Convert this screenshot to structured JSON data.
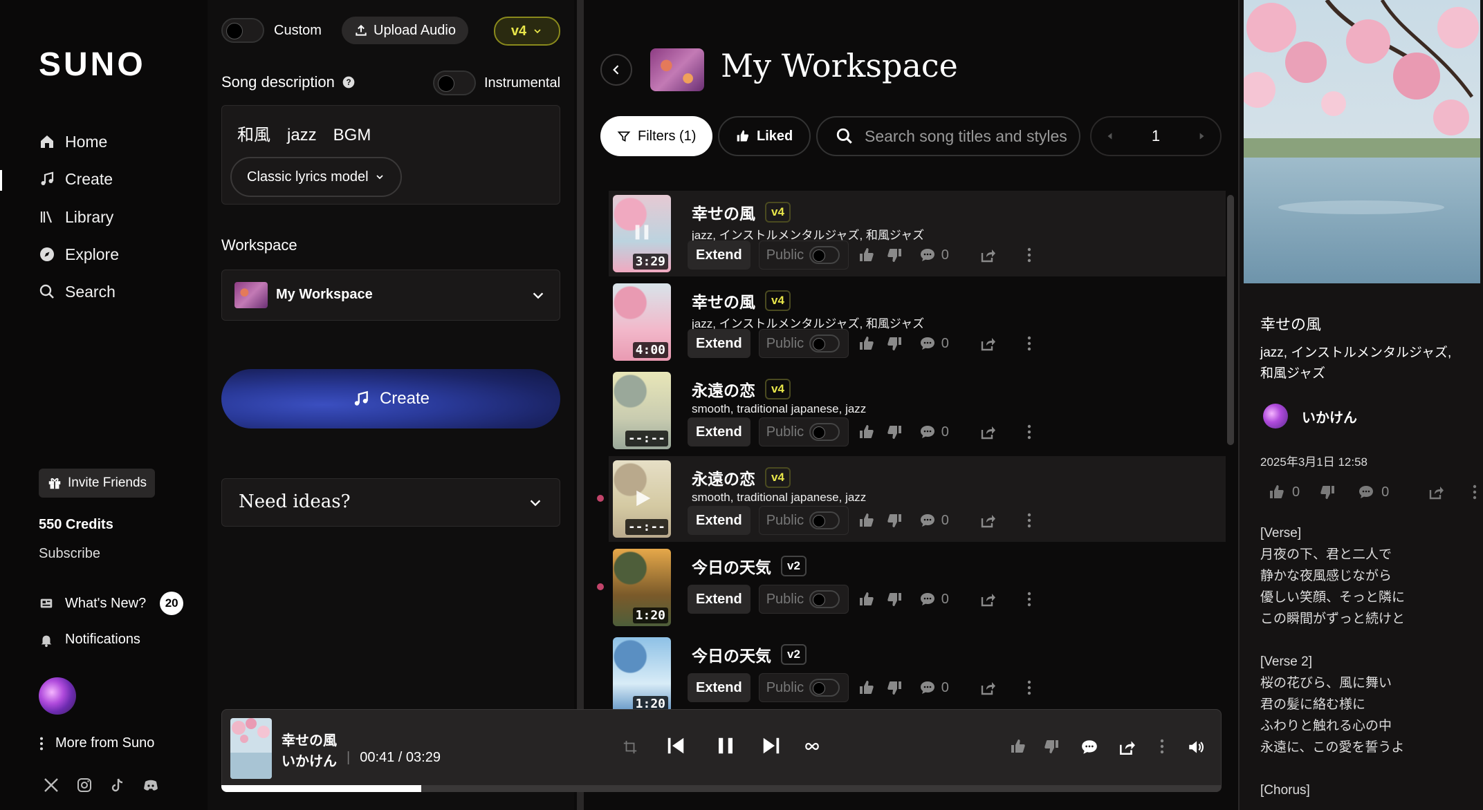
{
  "brand": "SUNO",
  "nav": {
    "home": "Home",
    "create": "Create",
    "library": "Library",
    "explore": "Explore",
    "search": "Search"
  },
  "sidebar": {
    "invite": "Invite Friends",
    "credits": "550 Credits",
    "subscribe": "Subscribe",
    "whats_new": "What's New?",
    "whats_new_count": "20",
    "notifications": "Notifications",
    "more": "More from Suno"
  },
  "create_panel": {
    "custom_label": "Custom",
    "upload_label": "Upload Audio",
    "version": "v4",
    "song_description_label": "Song description",
    "instrumental_label": "Instrumental",
    "description_value": "和風　jazz　BGM",
    "lyrics_model": "Classic lyrics model",
    "workspace_label": "Workspace",
    "workspace_value": "My Workspace",
    "create_button": "Create",
    "need_ideas": "Need ideas?"
  },
  "workspace": {
    "title": "My Workspace",
    "filters": "Filters (1)",
    "liked": "Liked",
    "search_placeholder": "Search song titles and styles",
    "page": "1"
  },
  "songs": [
    {
      "title": "幸せの風",
      "version": "v4",
      "tags": "jazz, インストルメンタルジャズ, 和風ジャズ",
      "duration": "3:29",
      "extend": "Extend",
      "public": "Public",
      "comments": "0"
    },
    {
      "title": "幸せの風",
      "version": "v4",
      "tags": "jazz, インストルメンタルジャズ, 和風ジャズ",
      "duration": "4:00",
      "extend": "Extend",
      "public": "Public",
      "comments": "0"
    },
    {
      "title": "永遠の恋",
      "version": "v4",
      "tags": "smooth, traditional japanese, jazz",
      "duration": "--:--",
      "extend": "Extend",
      "public": "Public",
      "comments": "0"
    },
    {
      "title": "永遠の恋",
      "version": "v4",
      "tags": "smooth, traditional japanese, jazz",
      "duration": "--:--",
      "extend": "Extend",
      "public": "Public",
      "comments": "0"
    },
    {
      "title": "今日の天気",
      "version": "v2",
      "tags": "",
      "duration": "1:20",
      "extend": "Extend",
      "public": "Public",
      "comments": "0"
    },
    {
      "title": "今日の天気",
      "version": "v2",
      "tags": "",
      "duration": "1:20",
      "extend": "Extend",
      "public": "Public",
      "comments": "0"
    }
  ],
  "player": {
    "title": "幸せの風",
    "artist": "いかけん",
    "separator": "|",
    "time": "00:41 / 03:29",
    "progress": 0.2
  },
  "detail": {
    "title": "幸せの風",
    "tags": "jazz, インストルメンタルジャズ, 和風ジャズ",
    "user": "いかけん",
    "date": "2025年3月1日 12:58",
    "likes": "0",
    "comments": "0",
    "lyrics": [
      "[Verse]",
      "月夜の下、君と二人で",
      "静かな夜風感じながら",
      "優しい笑顔、そっと隣に",
      "この瞬間がずっと続けと",
      "",
      "[Verse 2]",
      "桜の花びら、風に舞い",
      "君の髪に絡む様に",
      "ふわりと触れる心の中",
      "永遠に、この愛を誓うよ",
      "",
      "[Chorus]"
    ]
  },
  "colors": {
    "accent_version": "#e8e64a",
    "create_button": "#2a3a9a",
    "unread_dot": "#c2446a"
  }
}
